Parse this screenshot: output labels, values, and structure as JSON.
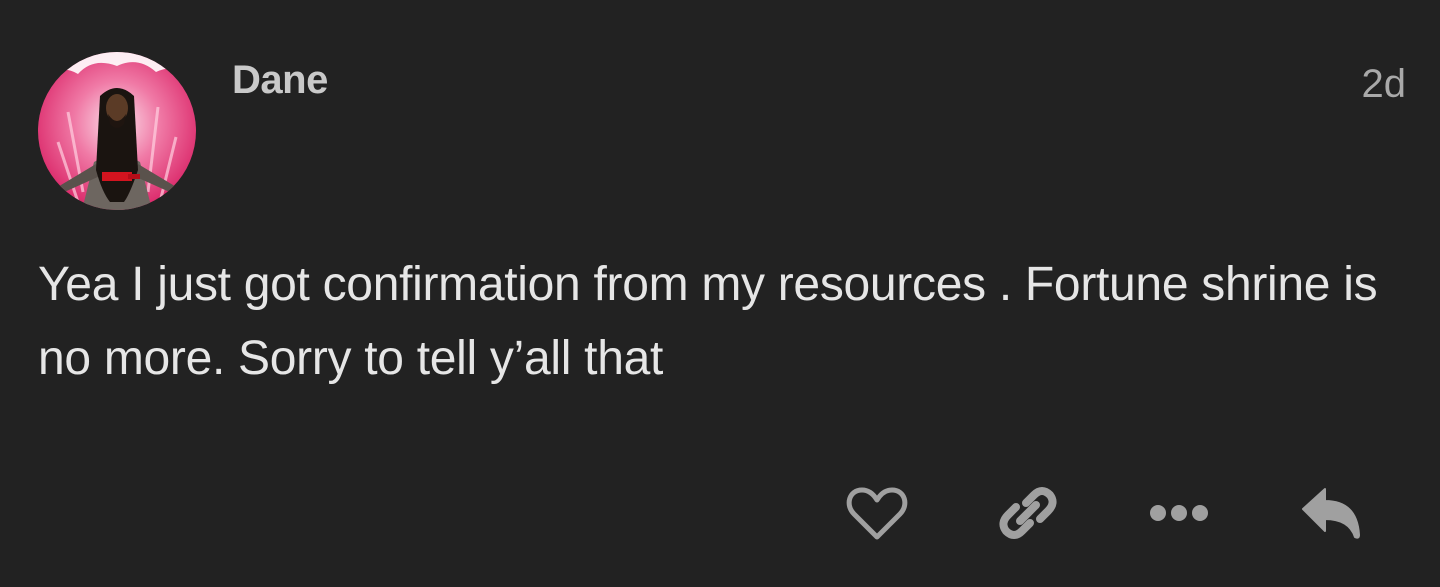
{
  "post": {
    "author": "Dane",
    "timestamp": "2d",
    "body": "Yea I just got confirmation from my resources . Fortune shrine is no more. Sorry to tell y’all that",
    "avatar_icon": "user-avatar",
    "accent": "#e8387a"
  },
  "actions": [
    {
      "icon": "heart-icon"
    },
    {
      "icon": "link-icon"
    },
    {
      "icon": "ellipsis-icon"
    },
    {
      "icon": "reply-icon"
    }
  ],
  "colors": {
    "background": "#222222",
    "text": "#e6e6e6",
    "muted": "#a9a9a9",
    "icon": "#a0a0a0"
  }
}
